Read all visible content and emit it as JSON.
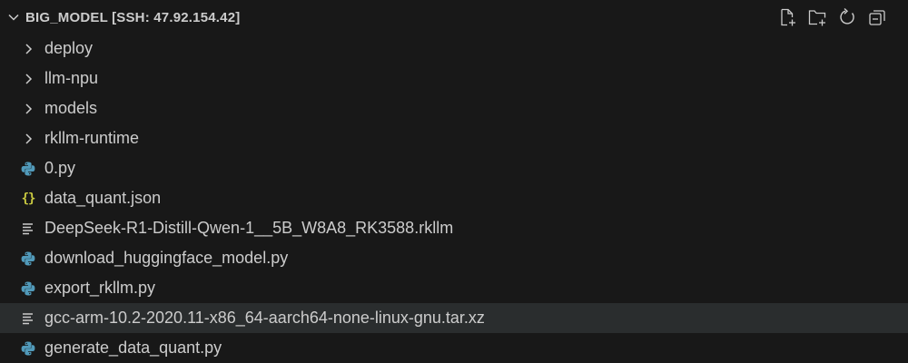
{
  "explorer": {
    "title": "BIG_MODEL [SSH: 47.92.154.42]",
    "actions": [
      {
        "name": "new-file-icon"
      },
      {
        "name": "new-folder-icon"
      },
      {
        "name": "refresh-icon"
      },
      {
        "name": "collapse-all-icon"
      }
    ],
    "items": [
      {
        "label": "deploy",
        "kind": "folder",
        "icon": "chevron-right-icon"
      },
      {
        "label": "llm-npu",
        "kind": "folder",
        "icon": "chevron-right-icon"
      },
      {
        "label": "models",
        "kind": "folder",
        "icon": "chevron-right-icon"
      },
      {
        "label": "rkllm-runtime",
        "kind": "folder",
        "icon": "chevron-right-icon"
      },
      {
        "label": "0.py",
        "kind": "python",
        "icon": "python-icon"
      },
      {
        "label": "data_quant.json",
        "kind": "json",
        "icon": "json-icon"
      },
      {
        "label": "DeepSeek-R1-Distill-Qwen-1__5B_W8A8_RK3588.rkllm",
        "kind": "text",
        "icon": "text-file-icon"
      },
      {
        "label": "download_huggingface_model.py",
        "kind": "python",
        "icon": "python-icon"
      },
      {
        "label": "export_rkllm.py",
        "kind": "python",
        "icon": "python-icon"
      },
      {
        "label": "gcc-arm-10.2-2020.11-x86_64-aarch64-none-linux-gnu.tar.xz",
        "kind": "text",
        "icon": "text-file-icon",
        "selected": true
      },
      {
        "label": "generate_data_quant.py",
        "kind": "python",
        "icon": "python-icon"
      }
    ],
    "json_glyph": "{}"
  }
}
